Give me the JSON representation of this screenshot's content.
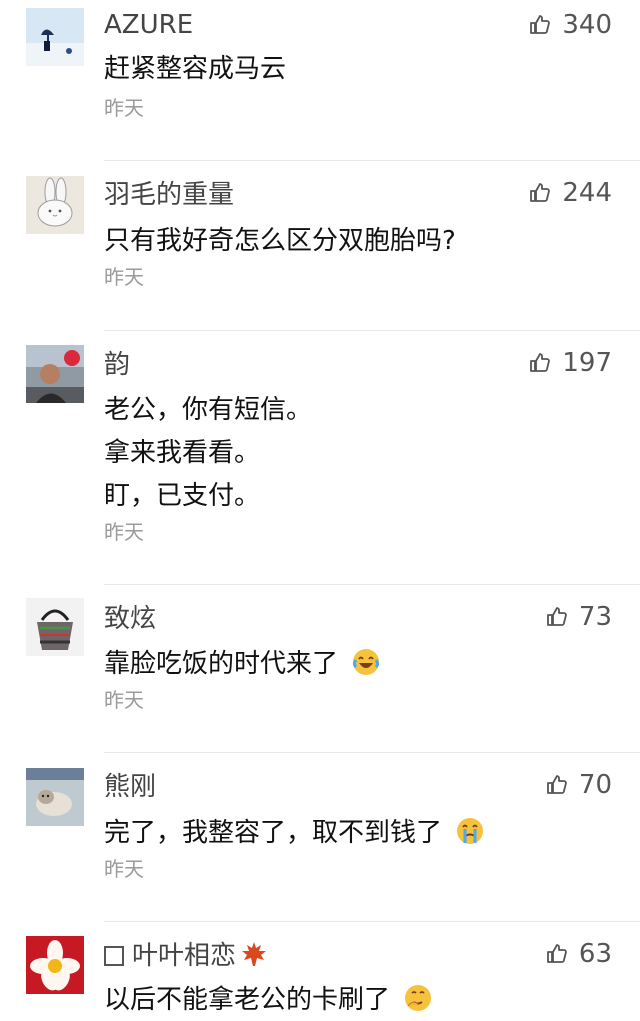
{
  "comments": [
    {
      "username": "AZURE",
      "likes": "340",
      "lines": [
        "赶紧整容成马云"
      ],
      "time": "昨天",
      "avatar": "umbrella-photo"
    },
    {
      "username": "羽毛的重量",
      "likes": "244",
      "lines": [
        "只有我好奇怎么区分双胞胎吗?"
      ],
      "time": "昨天",
      "avatar": "rabbit-drawing"
    },
    {
      "username": "韵",
      "likes": "197",
      "lines": [
        "老公，你有短信。",
        "拿来我看看。",
        "盯，已支付。"
      ],
      "time": "昨天",
      "avatar": "dark-portrait"
    },
    {
      "username": "致炫",
      "likes": "73",
      "lines": [
        "靠脸吃饭的时代来了"
      ],
      "time": "昨天",
      "avatar": "handbag-photo",
      "emoji": "laughing-tears-emoji"
    },
    {
      "username": "熊刚",
      "likes": "70",
      "lines": [
        "完了，我整容了，取不到钱了"
      ],
      "time": "昨天",
      "avatar": "cat-photo",
      "emoji": "crying-emoji"
    },
    {
      "username": "叶叶相恋",
      "likes": "63",
      "lines": [
        "以后不能拿老公的卡刷了"
      ],
      "time": "",
      "avatar": "flower-photo",
      "emoji": "thinking-emoji",
      "name_prefix_icon": "checkbox-icon",
      "name_suffix_icon": "maple-leaf-icon"
    }
  ],
  "colors": {
    "username": "#444444",
    "body": "#111111",
    "time": "#9a9a9a",
    "divider": "#e9e9e9"
  }
}
